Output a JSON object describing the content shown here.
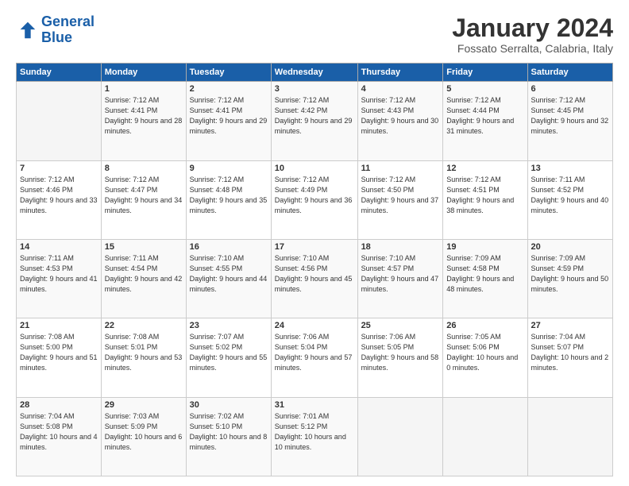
{
  "header": {
    "logo_line1": "General",
    "logo_line2": "Blue",
    "title": "January 2024",
    "subtitle": "Fossato Serralta, Calabria, Italy"
  },
  "columns": [
    "Sunday",
    "Monday",
    "Tuesday",
    "Wednesday",
    "Thursday",
    "Friday",
    "Saturday"
  ],
  "rows": [
    [
      {
        "day": "",
        "sunrise": "",
        "sunset": "",
        "daylight": ""
      },
      {
        "day": "1",
        "sunrise": "Sunrise: 7:12 AM",
        "sunset": "Sunset: 4:41 PM",
        "daylight": "Daylight: 9 hours and 28 minutes."
      },
      {
        "day": "2",
        "sunrise": "Sunrise: 7:12 AM",
        "sunset": "Sunset: 4:41 PM",
        "daylight": "Daylight: 9 hours and 29 minutes."
      },
      {
        "day": "3",
        "sunrise": "Sunrise: 7:12 AM",
        "sunset": "Sunset: 4:42 PM",
        "daylight": "Daylight: 9 hours and 29 minutes."
      },
      {
        "day": "4",
        "sunrise": "Sunrise: 7:12 AM",
        "sunset": "Sunset: 4:43 PM",
        "daylight": "Daylight: 9 hours and 30 minutes."
      },
      {
        "day": "5",
        "sunrise": "Sunrise: 7:12 AM",
        "sunset": "Sunset: 4:44 PM",
        "daylight": "Daylight: 9 hours and 31 minutes."
      },
      {
        "day": "6",
        "sunrise": "Sunrise: 7:12 AM",
        "sunset": "Sunset: 4:45 PM",
        "daylight": "Daylight: 9 hours and 32 minutes."
      }
    ],
    [
      {
        "day": "7",
        "sunrise": "Sunrise: 7:12 AM",
        "sunset": "Sunset: 4:46 PM",
        "daylight": "Daylight: 9 hours and 33 minutes."
      },
      {
        "day": "8",
        "sunrise": "Sunrise: 7:12 AM",
        "sunset": "Sunset: 4:47 PM",
        "daylight": "Daylight: 9 hours and 34 minutes."
      },
      {
        "day": "9",
        "sunrise": "Sunrise: 7:12 AM",
        "sunset": "Sunset: 4:48 PM",
        "daylight": "Daylight: 9 hours and 35 minutes."
      },
      {
        "day": "10",
        "sunrise": "Sunrise: 7:12 AM",
        "sunset": "Sunset: 4:49 PM",
        "daylight": "Daylight: 9 hours and 36 minutes."
      },
      {
        "day": "11",
        "sunrise": "Sunrise: 7:12 AM",
        "sunset": "Sunset: 4:50 PM",
        "daylight": "Daylight: 9 hours and 37 minutes."
      },
      {
        "day": "12",
        "sunrise": "Sunrise: 7:12 AM",
        "sunset": "Sunset: 4:51 PM",
        "daylight": "Daylight: 9 hours and 38 minutes."
      },
      {
        "day": "13",
        "sunrise": "Sunrise: 7:11 AM",
        "sunset": "Sunset: 4:52 PM",
        "daylight": "Daylight: 9 hours and 40 minutes."
      }
    ],
    [
      {
        "day": "14",
        "sunrise": "Sunrise: 7:11 AM",
        "sunset": "Sunset: 4:53 PM",
        "daylight": "Daylight: 9 hours and 41 minutes."
      },
      {
        "day": "15",
        "sunrise": "Sunrise: 7:11 AM",
        "sunset": "Sunset: 4:54 PM",
        "daylight": "Daylight: 9 hours and 42 minutes."
      },
      {
        "day": "16",
        "sunrise": "Sunrise: 7:10 AM",
        "sunset": "Sunset: 4:55 PM",
        "daylight": "Daylight: 9 hours and 44 minutes."
      },
      {
        "day": "17",
        "sunrise": "Sunrise: 7:10 AM",
        "sunset": "Sunset: 4:56 PM",
        "daylight": "Daylight: 9 hours and 45 minutes."
      },
      {
        "day": "18",
        "sunrise": "Sunrise: 7:10 AM",
        "sunset": "Sunset: 4:57 PM",
        "daylight": "Daylight: 9 hours and 47 minutes."
      },
      {
        "day": "19",
        "sunrise": "Sunrise: 7:09 AM",
        "sunset": "Sunset: 4:58 PM",
        "daylight": "Daylight: 9 hours and 48 minutes."
      },
      {
        "day": "20",
        "sunrise": "Sunrise: 7:09 AM",
        "sunset": "Sunset: 4:59 PM",
        "daylight": "Daylight: 9 hours and 50 minutes."
      }
    ],
    [
      {
        "day": "21",
        "sunrise": "Sunrise: 7:08 AM",
        "sunset": "Sunset: 5:00 PM",
        "daylight": "Daylight: 9 hours and 51 minutes."
      },
      {
        "day": "22",
        "sunrise": "Sunrise: 7:08 AM",
        "sunset": "Sunset: 5:01 PM",
        "daylight": "Daylight: 9 hours and 53 minutes."
      },
      {
        "day": "23",
        "sunrise": "Sunrise: 7:07 AM",
        "sunset": "Sunset: 5:02 PM",
        "daylight": "Daylight: 9 hours and 55 minutes."
      },
      {
        "day": "24",
        "sunrise": "Sunrise: 7:06 AM",
        "sunset": "Sunset: 5:04 PM",
        "daylight": "Daylight: 9 hours and 57 minutes."
      },
      {
        "day": "25",
        "sunrise": "Sunrise: 7:06 AM",
        "sunset": "Sunset: 5:05 PM",
        "daylight": "Daylight: 9 hours and 58 minutes."
      },
      {
        "day": "26",
        "sunrise": "Sunrise: 7:05 AM",
        "sunset": "Sunset: 5:06 PM",
        "daylight": "Daylight: 10 hours and 0 minutes."
      },
      {
        "day": "27",
        "sunrise": "Sunrise: 7:04 AM",
        "sunset": "Sunset: 5:07 PM",
        "daylight": "Daylight: 10 hours and 2 minutes."
      }
    ],
    [
      {
        "day": "28",
        "sunrise": "Sunrise: 7:04 AM",
        "sunset": "Sunset: 5:08 PM",
        "daylight": "Daylight: 10 hours and 4 minutes."
      },
      {
        "day": "29",
        "sunrise": "Sunrise: 7:03 AM",
        "sunset": "Sunset: 5:09 PM",
        "daylight": "Daylight: 10 hours and 6 minutes."
      },
      {
        "day": "30",
        "sunrise": "Sunrise: 7:02 AM",
        "sunset": "Sunset: 5:10 PM",
        "daylight": "Daylight: 10 hours and 8 minutes."
      },
      {
        "day": "31",
        "sunrise": "Sunrise: 7:01 AM",
        "sunset": "Sunset: 5:12 PM",
        "daylight": "Daylight: 10 hours and 10 minutes."
      },
      {
        "day": "",
        "sunrise": "",
        "sunset": "",
        "daylight": ""
      },
      {
        "day": "",
        "sunrise": "",
        "sunset": "",
        "daylight": ""
      },
      {
        "day": "",
        "sunrise": "",
        "sunset": "",
        "daylight": ""
      }
    ]
  ]
}
